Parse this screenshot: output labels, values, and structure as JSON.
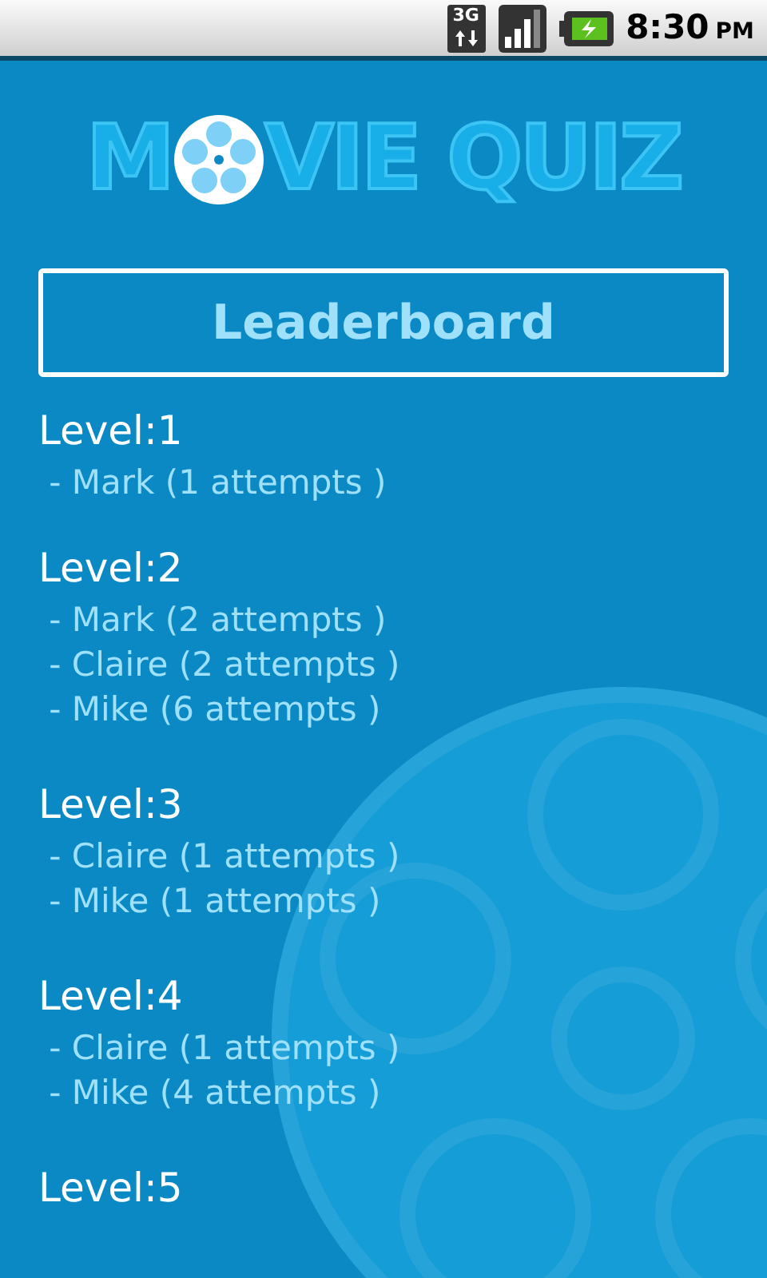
{
  "status_bar": {
    "network": "3G",
    "time": "8:30",
    "period": "PM"
  },
  "logo": {
    "before": "M",
    "after": "VIE QUIZ"
  },
  "title": "Leaderboard",
  "levels": [
    {
      "label": "Level:1",
      "entries": [
        " - Mark (1 attempts )"
      ]
    },
    {
      "label": "Level:2",
      "entries": [
        " - Mark (2 attempts )",
        " - Claire (2 attempts )",
        " - Mike (6 attempts )"
      ]
    },
    {
      "label": "Level:3",
      "entries": [
        " - Claire (1 attempts )",
        " - Mike (1 attempts )"
      ]
    },
    {
      "label": "Level:4",
      "entries": [
        " - Claire (1 attempts )",
        " - Mike (4 attempts )"
      ]
    },
    {
      "label": "Level:5"
    }
  ]
}
